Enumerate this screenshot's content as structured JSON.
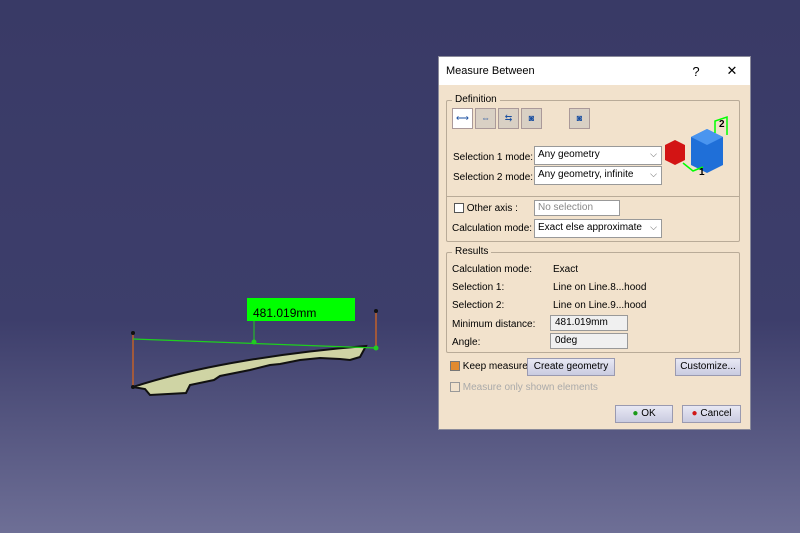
{
  "viewport": {
    "measure_label": "481.019mm"
  },
  "dialog": {
    "title": "Measure Between",
    "help": "?",
    "close": "✕",
    "definition": {
      "legend": "Definition",
      "sel1_label": "Selection 1 mode:",
      "sel1_value": "Any geometry",
      "sel2_label": "Selection 2 mode:",
      "sel2_value": "Any geometry, infinite",
      "other_axis_label": "Other axis :",
      "other_axis_value": "No selection",
      "calc_label": "Calculation mode:",
      "calc_value": "Exact else approximate",
      "img_label1": "1",
      "img_label2": "2"
    },
    "results": {
      "legend": "Results",
      "rows": [
        {
          "label": "Calculation mode:",
          "value": "Exact"
        },
        {
          "label": "Selection 1:",
          "value": "Line on Line.8...hood"
        },
        {
          "label": "Selection 2:",
          "value": "Line on Line.9...hood"
        }
      ],
      "min_label": "Minimum distance:",
      "min_value": "481.019mm",
      "angle_label": "Angle:",
      "angle_value": "0deg"
    },
    "keep_measure": "Keep measure",
    "keep_checked": true,
    "create_geometry": "Create geometry",
    "customize": "Customize...",
    "shown_only": "Measure only shown elements",
    "ok": "OK",
    "cancel": "Cancel"
  }
}
